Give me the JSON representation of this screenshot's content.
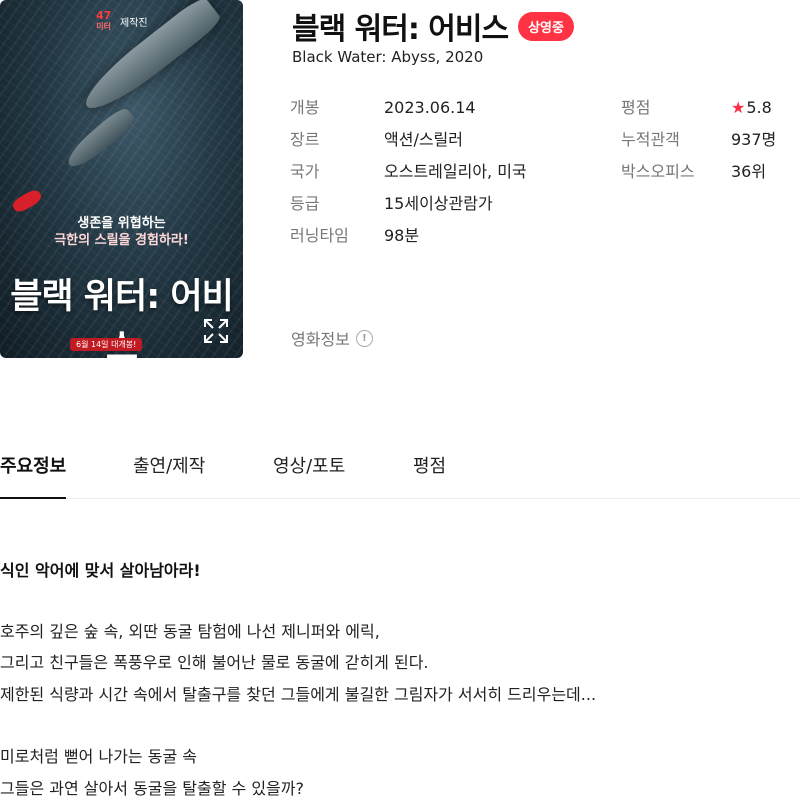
{
  "movie": {
    "title": "블랙 워터: 어비스",
    "status_badge": "상영중",
    "original_title": "Black Water: Abyss, 2020"
  },
  "poster": {
    "badge_number": "47",
    "badge_unit": "미터",
    "badge_suffix": "제작진",
    "tagline_line1": "생존을 위협하는",
    "tagline_line2": "극한의 스릴을 경험하라!",
    "title": "블랙 워터: 어비스",
    "release_banner": "6월 14일 대개봉!"
  },
  "details_left": [
    {
      "label": "개봉",
      "value": "2023.06.14"
    },
    {
      "label": "장르",
      "value": "액션/스릴러"
    },
    {
      "label": "국가",
      "value": "오스트레일리아, 미국"
    },
    {
      "label": "등급",
      "value": "15세이상관람가"
    },
    {
      "label": "러닝타임",
      "value": "98분"
    }
  ],
  "details_right": [
    {
      "label": "평점",
      "star": "★",
      "value": "5.8"
    },
    {
      "label": "누적관객",
      "star": "",
      "value": "937명"
    },
    {
      "label": "박스오피스",
      "star": "",
      "value": "36위"
    }
  ],
  "more_info": {
    "label": "영화정보",
    "icon": "info-icon"
  },
  "tabs": [
    {
      "label": "주요정보",
      "active": true
    },
    {
      "label": "출연/제작",
      "active": false
    },
    {
      "label": "영상/포토",
      "active": false
    },
    {
      "label": "평점",
      "active": false
    }
  ],
  "synopsis": {
    "headline": "식인 악어에 맞서 살아남아라!",
    "para1": [
      "호주의 깊은 숲 속, 외딴 동굴 탐험에 나선 제니퍼와 에릭,",
      "그리고 친구들은 폭풍우로 인해 불어난 물로 동굴에 갇히게 된다.",
      "제한된 식량과 시간 속에서 탈출구를 찾던 그들에게 불길한 그림자가 서서히 드리우는데..."
    ],
    "para2": [
      "미로처럼 뻗어 나가는 동굴 속",
      "그들은 과연 살아서 동굴을 탈출할 수 있을까?"
    ]
  },
  "colors": {
    "status_badge": "#ff3344",
    "star": "#ff2d46"
  }
}
